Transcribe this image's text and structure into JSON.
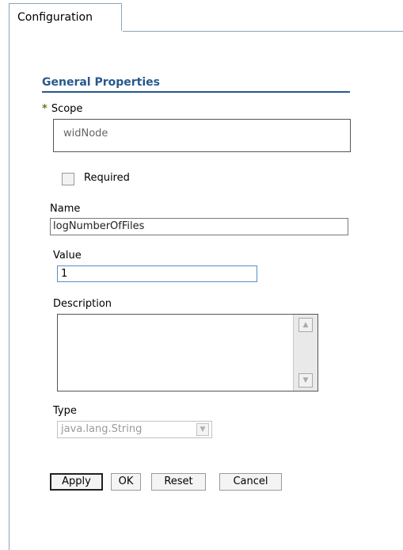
{
  "tabs": [
    {
      "label": "Configuration",
      "active": true
    }
  ],
  "section": {
    "title": "General Properties"
  },
  "scope": {
    "label": "Scope",
    "value": "widNode",
    "required_marker": "*"
  },
  "required": {
    "label": "Required",
    "checked": false
  },
  "name": {
    "label": "Name",
    "value": "logNumberOfFiles"
  },
  "value": {
    "label": "Value",
    "value": "1"
  },
  "description": {
    "label": "Description",
    "value": ""
  },
  "type": {
    "label": "Type",
    "selected": "java.lang.String"
  },
  "buttons": {
    "apply": "Apply",
    "ok": "OK",
    "reset": "Reset",
    "cancel": "Cancel"
  },
  "colors": {
    "accent": "#27598c",
    "tab_border": "#8aa4bf",
    "required_star": "#5f7c1c"
  }
}
